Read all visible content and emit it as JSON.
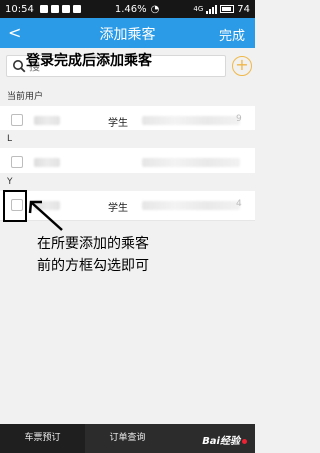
{
  "status_bar": {
    "time": "10:54",
    "signal_text": "1.46%",
    "network": "4G",
    "battery": "74"
  },
  "nav": {
    "back": "<",
    "title": "添加乘客",
    "done": "完成"
  },
  "search": {
    "placeholder": "搜",
    "annotation": "登录完成后添加乘客",
    "add_symbol": "+"
  },
  "sections": [
    {
      "header": "当前用户",
      "rows": [
        {
          "type": "学生",
          "id_tail": "9"
        }
      ]
    },
    {
      "header": "L",
      "rows": [
        {
          "type": "",
          "id_tail": ""
        }
      ]
    },
    {
      "header": "Y",
      "rows": [
        {
          "type": "学生",
          "id_tail": "4"
        }
      ]
    }
  ],
  "instruction": {
    "line1": "在所要添加的乘客",
    "line2": "前的方框勾选即可"
  },
  "bottom_tabs": [
    {
      "label": "车票预订"
    },
    {
      "label": "订单查询"
    },
    {
      "label": ""
    }
  ],
  "watermark": "Bai经验"
}
